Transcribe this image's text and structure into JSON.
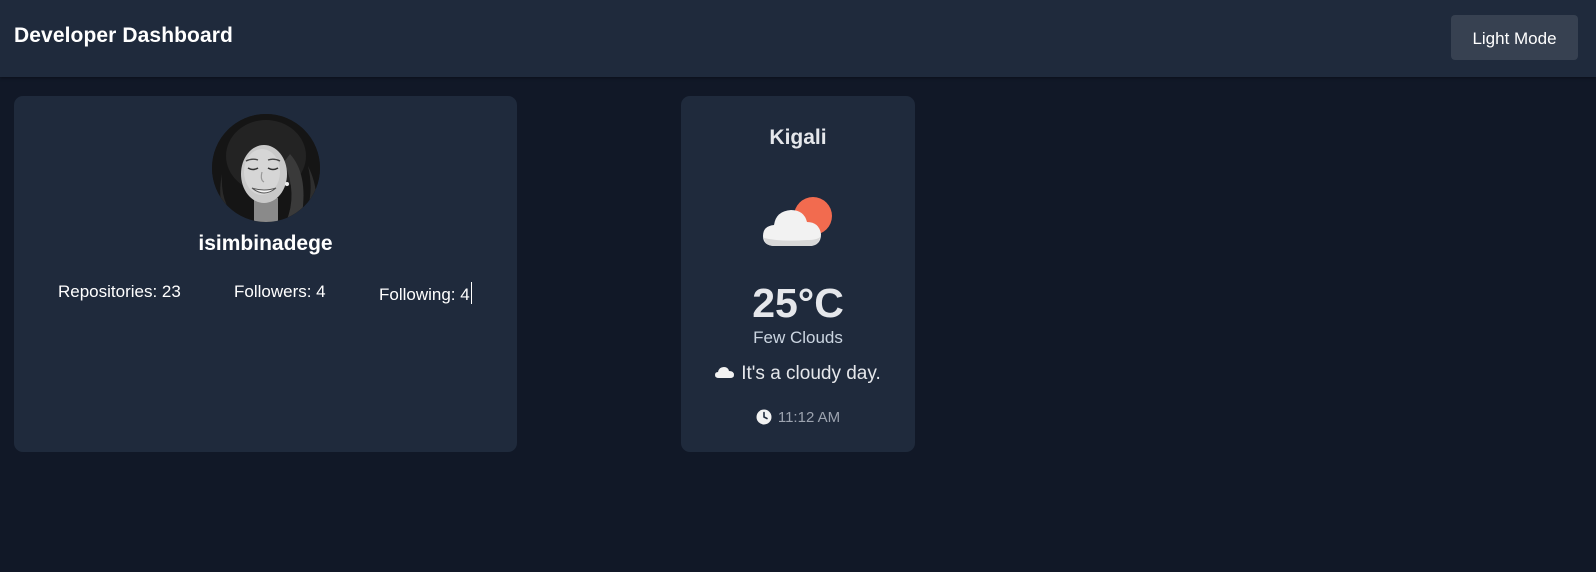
{
  "header": {
    "title": "Developer Dashboard",
    "mode_button_label": "Light Mode"
  },
  "profile": {
    "avatar_icon": "user-avatar-photo",
    "username": "isimbinadege",
    "stats": {
      "repositories": "Repositories: 23",
      "followers": "Followers: 4",
      "following": "Following: 4"
    }
  },
  "weather": {
    "city": "Kigali",
    "icon": "cloud-sun-icon",
    "temperature": "25°C",
    "condition": "Few Clouds",
    "message_icon": "cloud-icon",
    "message": "It's a cloudy day.",
    "time_icon": "clock-icon",
    "time": "11:12 AM"
  },
  "colors": {
    "background": "#111827",
    "surface": "#1f2a3c",
    "button": "#374151",
    "sun": "#f26b4f"
  }
}
